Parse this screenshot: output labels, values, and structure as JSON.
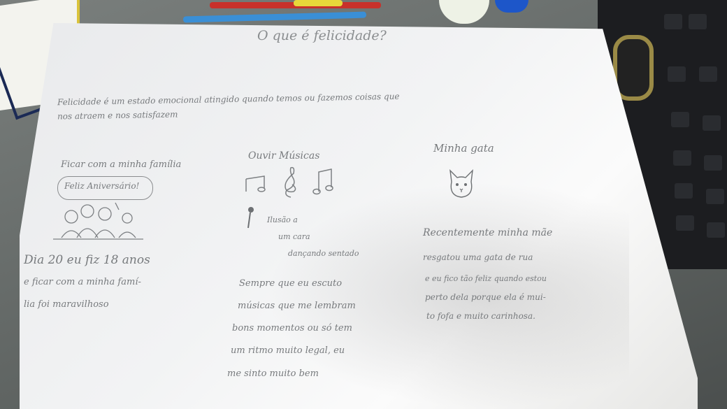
{
  "title": "O que é felicidade?",
  "intro": {
    "line1": "Felicidade é um estado emocional atingido quando temos ou fazemos coisas que",
    "line2": "nos atraem e nos satisfazem"
  },
  "family": {
    "heading": "Ficar com a minha família",
    "bubble": "Feliz Aniversário!",
    "line1": "Dia 20 eu fiz 18 anos",
    "line2": "e ficar com a minha famí-",
    "line3": "lia foi maravilhoso"
  },
  "music": {
    "heading": "Ouvir Músicas",
    "illustration1": "Ilusão a",
    "illustration2": "um cara",
    "illustration3": "dançando sentado",
    "line1": "Sempre que eu escuto",
    "line2": "músicas que me lembram",
    "line3": "bons momentos ou só tem",
    "line4": "um ritmo muito legal, eu",
    "line5": "me sinto muito bem"
  },
  "cat": {
    "heading": "Minha gata",
    "line1": "Recentemente minha mãe",
    "line2": "resgatou uma gata de rua",
    "line3": "e eu fico tão feliz quando estou",
    "line4": "perto dela porque ela é mui-",
    "line5": "to fofa e muito carinhosa."
  },
  "colors": {
    "pencil_ink": "#777a7d",
    "paper": "#f2f3f4",
    "keyboard": "#1c1d20",
    "keyboard_accent": "#9a8a46",
    "pen_blue": "#3a8fd6",
    "pen_red": "#c8312b",
    "pen_yellow": "#e8d83a"
  },
  "icons": [
    "music-note-icon",
    "treble-clef-icon",
    "eighth-notes-icon",
    "cat-face-icon",
    "microphone-icon",
    "family-drawing-icon"
  ]
}
